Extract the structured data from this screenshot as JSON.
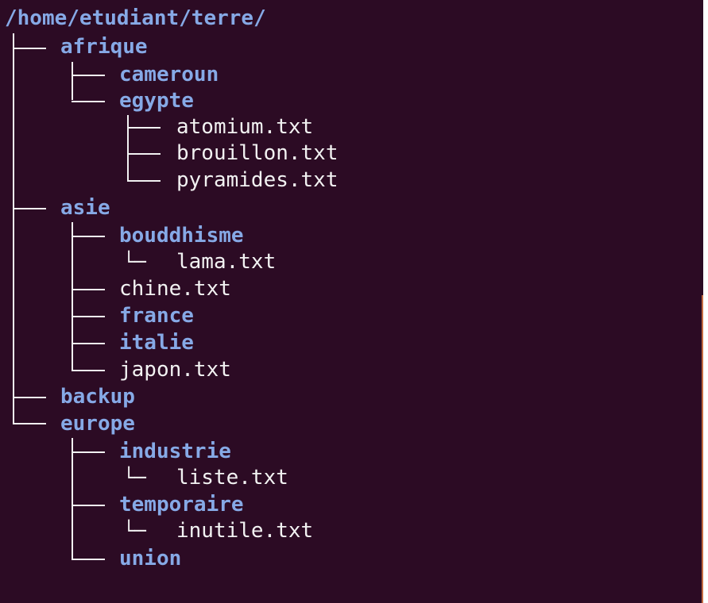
{
  "terminal": {
    "root_path": "/home/etudiant/terre/",
    "entries": {
      "afrique": "afrique",
      "cameroun": "cameroun",
      "egypte": "egypte",
      "atomium": "atomium.txt",
      "brouillon": "brouillon.txt",
      "pyramides": "pyramides.txt",
      "asie": "asie",
      "bouddhisme": "bouddhisme",
      "lama": "lama.txt",
      "chine": "chine.txt",
      "france": "france",
      "italie": "italie",
      "japon": "japon.txt",
      "backup": "backup",
      "europe": "europe",
      "industrie": "industrie",
      "liste": "liste.txt",
      "temporaire": "temporaire",
      "inutile": "inutile.txt",
      "union": "union"
    },
    "corner_glyph": "└─",
    "colors": {
      "background": "#2c0b24",
      "directory": "#86a9e6",
      "file": "#f2f2f2"
    }
  }
}
